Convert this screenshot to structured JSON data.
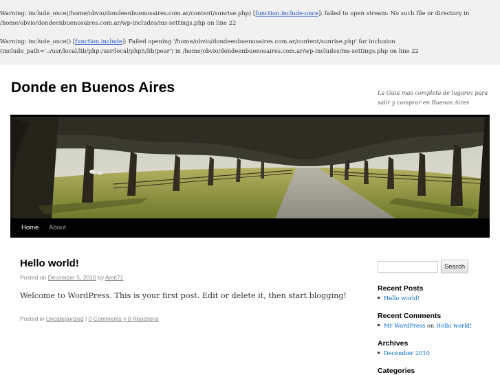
{
  "warnings": [
    {
      "line1_prefix": "Warning: include_once(/home/obvio/dondeenbuenosaires.com.ar/content/sunrise.php) [",
      "link": "function.include-once",
      "line1_suffix": "]: failed to open stream: No such file or directory in",
      "line2": "/home/obvio/dondeenbuenosaires.com.ar/wp-includes/ms-settings.php on line 22"
    },
    {
      "line1_prefix": "Warning: include_once() [",
      "link": "function.include",
      "line1_suffix": "]: Failed opening '/home/obvio/dondeenbuenosaires.com.ar/content/sunrise.php' for inclusion",
      "line2": "(include_path='.:/usr/local/lib/php:/usr/local/php5/lib/pear') in /home/obvio/dondeenbuenosaires.com.ar/wp-includes/ms-settings.php on line 22"
    }
  ],
  "header": {
    "title": "Donde en Buenos Aires",
    "description": "La Guia mas completa de lugares para salir y comprar en Buenos Aires"
  },
  "nav": {
    "items": [
      {
        "label": "Home"
      },
      {
        "label": "About"
      }
    ]
  },
  "post": {
    "title": "Hello world!",
    "meta_posted_on": "Posted on",
    "date": "December 5, 2010",
    "meta_by": "by",
    "author": "Amit71",
    "body": "Welcome to WordPress. This is your first post. Edit or delete it, then start blogging!",
    "posted_in": "Posted in",
    "category": "Uncategorized",
    "separator": "|",
    "comments": "0 Comments y 0 Reactions"
  },
  "sidebar": {
    "search_button": "Search",
    "search_value": "",
    "recent_posts_title": "Recent Posts",
    "recent_posts": [
      "Hello world!"
    ],
    "recent_comments_title": "Recent Comments",
    "recent_comment": {
      "author": "Mr WordPress",
      "on": "on",
      "post": "Hello world!"
    },
    "archives_title": "Archives",
    "archives": [
      "December 2010"
    ],
    "categories_title": "Categories"
  },
  "colors": {
    "link": "#0066cc",
    "nav_bg": "#000000",
    "warning_bg": "#f1f1f1"
  }
}
